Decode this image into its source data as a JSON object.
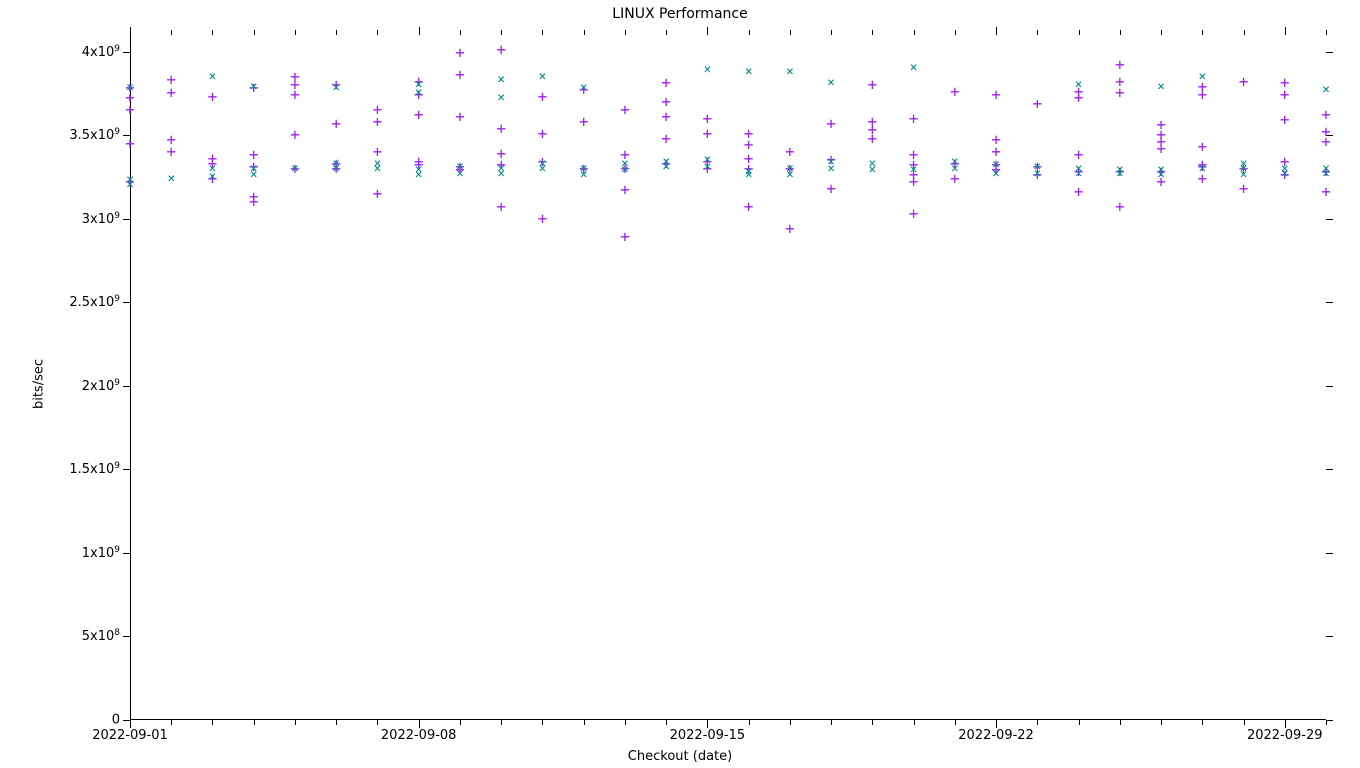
{
  "chart_data": {
    "type": "scatter",
    "title": "LINUX Performance",
    "xlabel": "Checkout (date)",
    "ylabel": "bits/sec",
    "ylim": [
      0,
      4100000000
    ],
    "y_ticks": [
      0,
      500000000,
      1000000000,
      1500000000,
      2000000000,
      2500000000,
      3000000000,
      3500000000,
      4000000000
    ],
    "y_tick_labels_html": [
      "0",
      "5x10<sup>8</sup>",
      "1x10<sup>9</sup>",
      "1.5x10<sup>9</sup>",
      "2x10<sup>9</sup>",
      "2.5x10<sup>9</sup>",
      "3x10<sup>9</sup>",
      "3.5x10<sup>9</sup>",
      "4x10<sup>9</sup>"
    ],
    "x_tick_major_dates": [
      "2022-09-01",
      "2022-09-08",
      "2022-09-15",
      "2022-09-22",
      "2022-09-29"
    ],
    "x_range_dates": [
      "2022-09-01",
      "2022-09-30"
    ],
    "colors": {
      "plus": "#a020f0",
      "cross": "#008b8b"
    },
    "series": [
      {
        "name": "plus",
        "marker": "+",
        "points": [
          [
            1,
            3450000000.0
          ],
          [
            1,
            3650000000.0
          ],
          [
            1,
            3720000000.0
          ],
          [
            1,
            3780000000.0
          ],
          [
            1,
            3220000000.0
          ],
          [
            2,
            3750000000.0
          ],
          [
            2,
            3830000000.0
          ],
          [
            2,
            3400000000.0
          ],
          [
            2,
            3470000000.0
          ],
          [
            3,
            3240000000.0
          ],
          [
            3,
            3730000000.0
          ],
          [
            3,
            3360000000.0
          ],
          [
            3,
            3330000000.0
          ],
          [
            4,
            3780000000.0
          ],
          [
            4,
            3100000000.0
          ],
          [
            4,
            3380000000.0
          ],
          [
            4,
            3310000000.0
          ],
          [
            4,
            3130000000.0
          ],
          [
            5,
            3800000000.0
          ],
          [
            5,
            3850000000.0
          ],
          [
            5,
            3740000000.0
          ],
          [
            5,
            3500000000.0
          ],
          [
            5,
            3300000000.0
          ],
          [
            6,
            3800000000.0
          ],
          [
            6,
            3570000000.0
          ],
          [
            6,
            3330000000.0
          ],
          [
            6,
            3300000000.0
          ],
          [
            7,
            3650000000.0
          ],
          [
            7,
            3580000000.0
          ],
          [
            7,
            3400000000.0
          ],
          [
            7,
            3150000000.0
          ],
          [
            8,
            3620000000.0
          ],
          [
            8,
            3820000000.0
          ],
          [
            8,
            3740000000.0
          ],
          [
            8,
            3320000000.0
          ],
          [
            8,
            3340000000.0
          ],
          [
            9,
            3610000000.0
          ],
          [
            9,
            3990000000.0
          ],
          [
            9,
            3290000000.0
          ],
          [
            9,
            3310000000.0
          ],
          [
            9,
            3860000000.0
          ],
          [
            10,
            4010000000.0
          ],
          [
            10,
            3390000000.0
          ],
          [
            10,
            3070000000.0
          ],
          [
            10,
            3320000000.0
          ],
          [
            10,
            3540000000.0
          ],
          [
            11,
            3730000000.0
          ],
          [
            11,
            3510000000.0
          ],
          [
            11,
            3340000000.0
          ],
          [
            11,
            3000000000.0
          ],
          [
            12,
            3770000000.0
          ],
          [
            12,
            3580000000.0
          ],
          [
            12,
            3300000000.0
          ],
          [
            13,
            3300000000.0
          ],
          [
            13,
            3650000000.0
          ],
          [
            13,
            2890000000.0
          ],
          [
            13,
            3380000000.0
          ],
          [
            13,
            3170000000.0
          ],
          [
            14,
            3810000000.0
          ],
          [
            14,
            3700000000.0
          ],
          [
            14,
            3610000000.0
          ],
          [
            14,
            3480000000.0
          ],
          [
            14,
            3330000000.0
          ],
          [
            15,
            3600000000.0
          ],
          [
            15,
            3340000000.0
          ],
          [
            15,
            3510000000.0
          ],
          [
            15,
            3300000000.0
          ],
          [
            16,
            3510000000.0
          ],
          [
            16,
            3070000000.0
          ],
          [
            16,
            3300000000.0
          ],
          [
            16,
            3360000000.0
          ],
          [
            16,
            3440000000.0
          ],
          [
            17,
            3400000000.0
          ],
          [
            17,
            2940000000.0
          ],
          [
            17,
            3300000000.0
          ],
          [
            18,
            3570000000.0
          ],
          [
            18,
            3180000000.0
          ],
          [
            18,
            3350000000.0
          ],
          [
            19,
            3580000000.0
          ],
          [
            19,
            3800000000.0
          ],
          [
            19,
            3530000000.0
          ],
          [
            19,
            3480000000.0
          ],
          [
            20,
            3600000000.0
          ],
          [
            20,
            3320000000.0
          ],
          [
            20,
            3030000000.0
          ],
          [
            20,
            3220000000.0
          ],
          [
            20,
            3380000000.0
          ],
          [
            20,
            3260000000.0
          ],
          [
            21,
            3760000000.0
          ],
          [
            21,
            3330000000.0
          ],
          [
            21,
            3240000000.0
          ],
          [
            22,
            3740000000.0
          ],
          [
            22,
            3290000000.0
          ],
          [
            22,
            3400000000.0
          ],
          [
            22,
            3470000000.0
          ],
          [
            22,
            3320000000.0
          ],
          [
            23,
            3690000000.0
          ],
          [
            23,
            3310000000.0
          ],
          [
            23,
            3260000000.0
          ],
          [
            24,
            3760000000.0
          ],
          [
            24,
            3160000000.0
          ],
          [
            24,
            3720000000.0
          ],
          [
            24,
            3380000000.0
          ],
          [
            24,
            3280000000.0
          ],
          [
            25,
            3920000000.0
          ],
          [
            25,
            3820000000.0
          ],
          [
            25,
            3750000000.0
          ],
          [
            25,
            3070000000.0
          ],
          [
            25,
            3280000000.0
          ],
          [
            26,
            3560000000.0
          ],
          [
            26,
            3420000000.0
          ],
          [
            26,
            3460000000.0
          ],
          [
            26,
            3500000000.0
          ],
          [
            26,
            3280000000.0
          ],
          [
            26,
            3220000000.0
          ],
          [
            27,
            3790000000.0
          ],
          [
            27,
            3740000000.0
          ],
          [
            27,
            3430000000.0
          ],
          [
            27,
            3310000000.0
          ],
          [
            27,
            3240000000.0
          ],
          [
            27,
            3320000000.0
          ],
          [
            28,
            3820000000.0
          ],
          [
            28,
            3300000000.0
          ],
          [
            28,
            3180000000.0
          ],
          [
            29,
            3810000000.0
          ],
          [
            29,
            3590000000.0
          ],
          [
            29,
            3740000000.0
          ],
          [
            29,
            3340000000.0
          ],
          [
            29,
            3260000000.0
          ],
          [
            30,
            3620000000.0
          ],
          [
            30,
            3520000000.0
          ],
          [
            30,
            3460000000.0
          ],
          [
            30,
            3280000000.0
          ],
          [
            30,
            3160000000.0
          ]
        ]
      },
      {
        "name": "cross",
        "marker": "x",
        "points": [
          [
            1,
            3780000000.0
          ],
          [
            1,
            3200000000.0
          ],
          [
            1,
            3230000000.0
          ],
          [
            2,
            3240000000.0
          ],
          [
            3,
            3300000000.0
          ],
          [
            3,
            3850000000.0
          ],
          [
            3,
            3250000000.0
          ],
          [
            4,
            3790000000.0
          ],
          [
            4,
            3260000000.0
          ],
          [
            4,
            3300000000.0
          ],
          [
            5,
            3300000000.0
          ],
          [
            6,
            3780000000.0
          ],
          [
            6,
            3330000000.0
          ],
          [
            6,
            3300000000.0
          ],
          [
            7,
            3300000000.0
          ],
          [
            7,
            3330000000.0
          ],
          [
            8,
            3800000000.0
          ],
          [
            8,
            3750000000.0
          ],
          [
            8,
            3290000000.0
          ],
          [
            8,
            3260000000.0
          ],
          [
            9,
            3270000000.0
          ],
          [
            9,
            3310000000.0
          ],
          [
            10,
            3830000000.0
          ],
          [
            10,
            3720000000.0
          ],
          [
            10,
            3300000000.0
          ],
          [
            10,
            3270000000.0
          ],
          [
            11,
            3300000000.0
          ],
          [
            11,
            3850000000.0
          ],
          [
            11,
            3330000000.0
          ],
          [
            12,
            3780000000.0
          ],
          [
            12,
            3300000000.0
          ],
          [
            12,
            3260000000.0
          ],
          [
            13,
            3330000000.0
          ],
          [
            13,
            3290000000.0
          ],
          [
            14,
            3340000000.0
          ],
          [
            14,
            3310000000.0
          ],
          [
            15,
            3890000000.0
          ],
          [
            15,
            3310000000.0
          ],
          [
            15,
            3350000000.0
          ],
          [
            16,
            3880000000.0
          ],
          [
            16,
            3280000000.0
          ],
          [
            16,
            3260000000.0
          ],
          [
            17,
            3880000000.0
          ],
          [
            17,
            3300000000.0
          ],
          [
            17,
            3260000000.0
          ],
          [
            18,
            3810000000.0
          ],
          [
            18,
            3300000000.0
          ],
          [
            18,
            3340000000.0
          ],
          [
            19,
            3330000000.0
          ],
          [
            19,
            3290000000.0
          ],
          [
            20,
            3900000000.0
          ],
          [
            20,
            3290000000.0
          ],
          [
            21,
            3340000000.0
          ],
          [
            21,
            3300000000.0
          ],
          [
            22,
            3320000000.0
          ],
          [
            22,
            3270000000.0
          ],
          [
            23,
            3270000000.0
          ],
          [
            23,
            3310000000.0
          ],
          [
            24,
            3800000000.0
          ],
          [
            24,
            3270000000.0
          ],
          [
            24,
            3300000000.0
          ],
          [
            25,
            3270000000.0
          ],
          [
            25,
            3290000000.0
          ],
          [
            26,
            3790000000.0
          ],
          [
            26,
            3260000000.0
          ],
          [
            26,
            3290000000.0
          ],
          [
            27,
            3850000000.0
          ],
          [
            27,
            3300000000.0
          ],
          [
            28,
            3300000000.0
          ],
          [
            28,
            3330000000.0
          ],
          [
            28,
            3260000000.0
          ],
          [
            29,
            3270000000.0
          ],
          [
            29,
            3300000000.0
          ],
          [
            30,
            3770000000.0
          ],
          [
            30,
            3300000000.0
          ],
          [
            30,
            3270000000.0
          ]
        ]
      }
    ]
  }
}
